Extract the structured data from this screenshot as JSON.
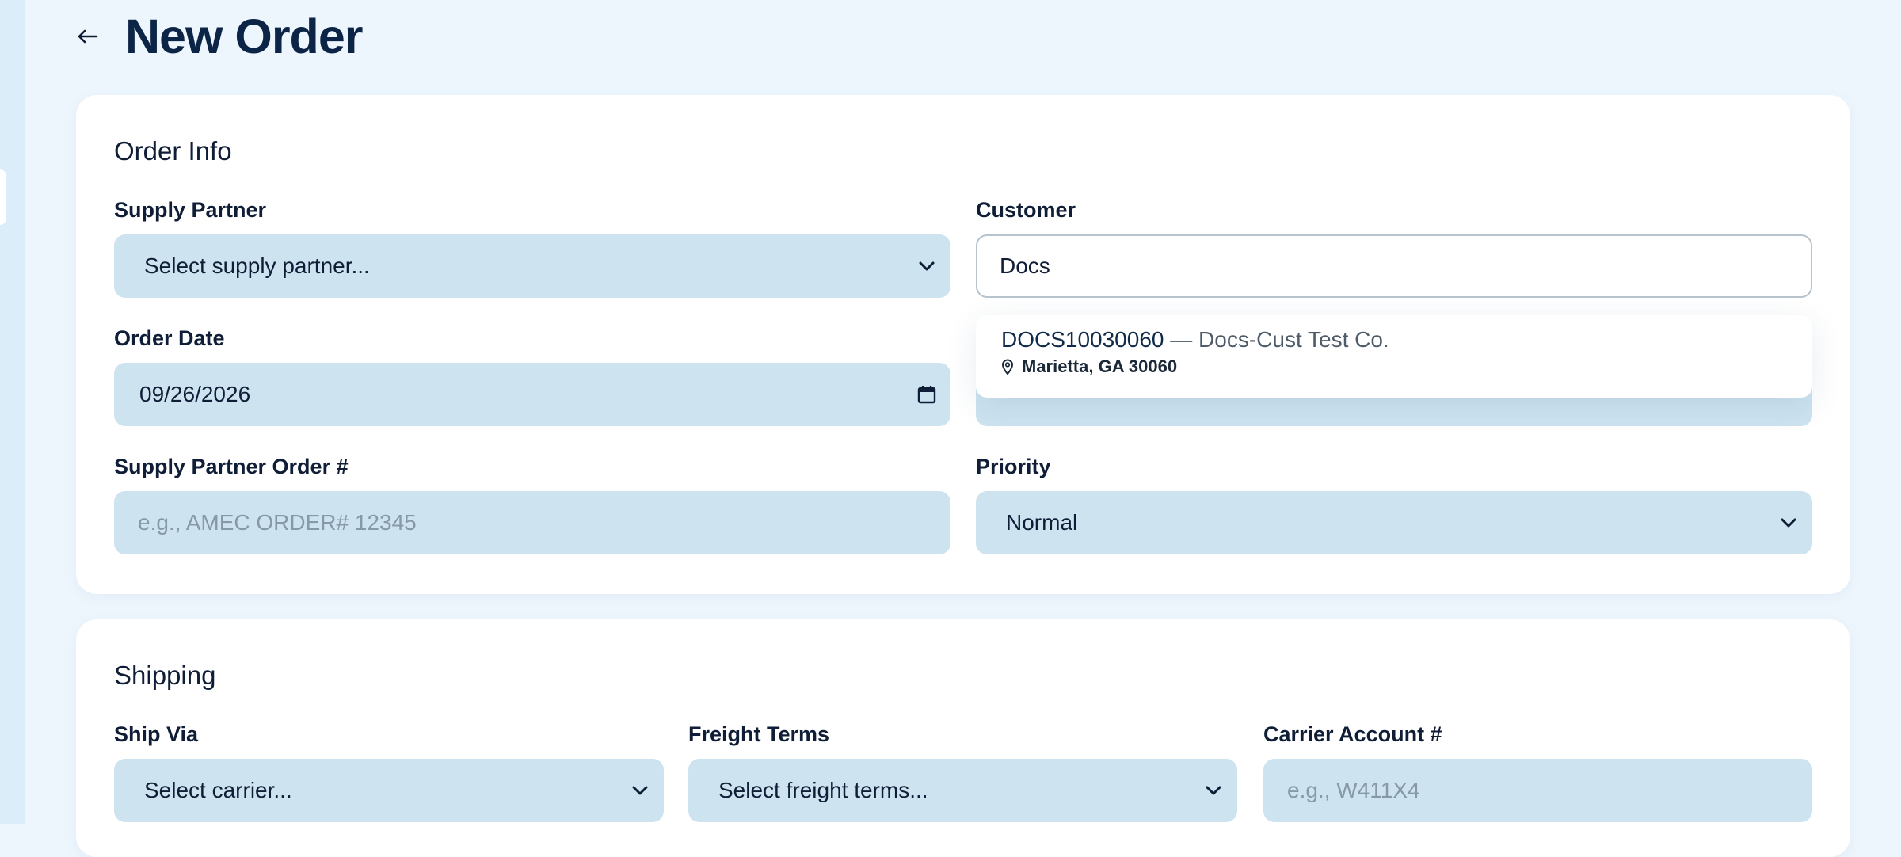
{
  "page": {
    "title": "New Order"
  },
  "order_info": {
    "title": "Order Info",
    "supply_partner": {
      "label": "Supply Partner",
      "value": "Select supply partner..."
    },
    "customer": {
      "label": "Customer",
      "value": "Docs",
      "suggestions": [
        {
          "code": "DOCS10030060",
          "separator": "—",
          "name": "Docs-Cust Test Co.",
          "location": "Marietta, GA 30060"
        }
      ]
    },
    "order_date": {
      "label": "Order Date",
      "value": "09/26/2026"
    },
    "supply_partner_order": {
      "label": "Supply Partner Order #",
      "placeholder": "e.g., AMEC ORDER# 12345"
    },
    "priority": {
      "label": "Priority",
      "value": "Normal"
    }
  },
  "shipping": {
    "title": "Shipping",
    "ship_via": {
      "label": "Ship Via",
      "value": "Select carrier..."
    },
    "freight_terms": {
      "label": "Freight Terms",
      "value": "Select freight terms..."
    },
    "carrier_account": {
      "label": "Carrier Account #",
      "placeholder": "e.g., W411X4"
    }
  },
  "colors": {
    "field_bg": "#cde3f0",
    "page_bg": "#eef6fd",
    "title": "#0c2446"
  },
  "icons": {
    "back": "arrow-left-icon",
    "chevron": "chevron-down-icon",
    "calendar": "calendar-icon",
    "pin": "map-pin-icon"
  }
}
